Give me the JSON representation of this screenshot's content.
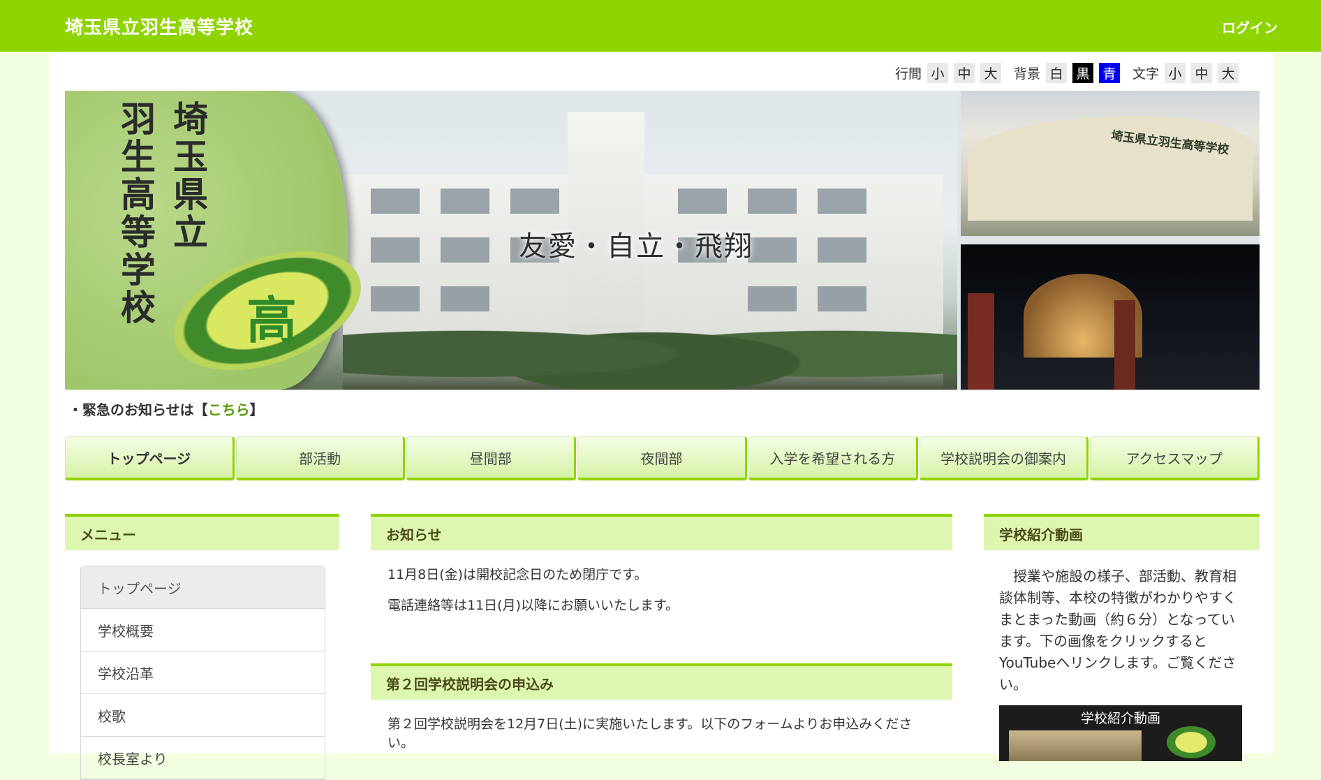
{
  "header": {
    "site_title": "埼玉県立羽生高等学校",
    "login_label": "ログイン"
  },
  "accessibility": {
    "line_spacing_label": "行間",
    "line_spacing_options": [
      "小",
      "中",
      "大"
    ],
    "background_label": "背景",
    "background_options": [
      "白",
      "黒",
      "青"
    ],
    "text_label": "文字",
    "text_options": [
      "小",
      "中",
      "大"
    ]
  },
  "hero": {
    "school_name_columns": [
      "埼玉県立",
      "羽生高等学校"
    ],
    "emblem_char": "高",
    "motto": "友愛・自立・飛翔",
    "gym_sign": "埼玉県立羽生高等学校"
  },
  "emergency": {
    "text": "・緊急のお知らせは【",
    "link": "こちら",
    "suffix": "】"
  },
  "nav": {
    "items": [
      "トップページ",
      "部活動",
      "昼間部",
      "夜間部",
      "入学を希望される方",
      "学校説明会の御案内",
      "アクセスマップ"
    ]
  },
  "menu": {
    "title": "メニュー",
    "items": [
      "トップページ",
      "学校概要",
      "学校沿革",
      "校歌",
      "校長室より"
    ]
  },
  "news": [
    {
      "title": "お知らせ",
      "lines": [
        "11月8日(金)は開校記念日のため閉庁です。",
        "電話連絡等は11日(月)以降にお願いいたします。"
      ]
    },
    {
      "title": "第２回学校説明会の申込み",
      "lines": [
        "第２回学校説明会を12月7日(土)に実施いたします。以下のフォームよりお申込みください。"
      ]
    }
  ],
  "video": {
    "title": "学校紹介動画",
    "description": "　授業や施設の様子、部活動、教育相談体制等、本校の特徴がわかりやすくまとまった動画（約６分）となっています。下の画像をクリックするとYouTubeへリンクします。ご覧ください。",
    "thumb_title": "学校紹介動画"
  },
  "colors": {
    "brand_green": "#8fd400",
    "panel_bg": "#ddf7b0"
  }
}
